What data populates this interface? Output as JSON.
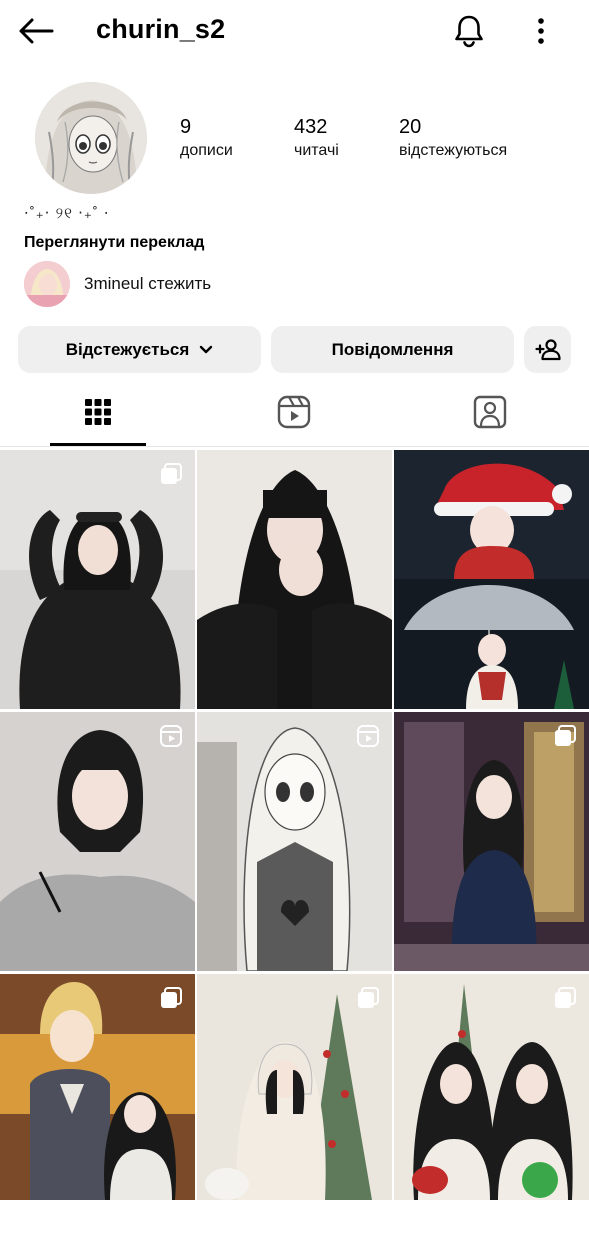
{
  "header": {
    "username": "churin_s2"
  },
  "profile": {
    "stats": [
      {
        "value": "9",
        "label": "дописи"
      },
      {
        "value": "432",
        "label": "читачі"
      },
      {
        "value": "20",
        "label": "відстежуються"
      }
    ],
    "bio": "⋅˚₊‧ ୨୧ ‧₊˚ ⋅",
    "translate_label": "Переглянути переклад",
    "followed_by": {
      "name": "3mineul",
      "suffix": " стежить"
    }
  },
  "actions": {
    "following_label": "Відстежується",
    "message_label": "Повідомлення"
  },
  "tabs": [
    {
      "icon": "grid-icon",
      "active": true
    },
    {
      "icon": "reels-icon",
      "active": false
    },
    {
      "icon": "tagged-icon",
      "active": false
    }
  ],
  "posts": [
    {
      "type": "carousel",
      "subject": "girl in black sweatshirt"
    },
    {
      "type": "photo",
      "subject": "girl covering face"
    },
    {
      "type": "photo",
      "subject": "santa hat and umbrella collage"
    },
    {
      "type": "reel",
      "subject": "girl in grey top"
    },
    {
      "type": "reel",
      "subject": "manga girl illustration"
    },
    {
      "type": "carousel",
      "subject": "girl in navy cardigan"
    },
    {
      "type": "carousel",
      "subject": "anime cutout with girl"
    },
    {
      "type": "carousel",
      "subject": "girl with headscarf by tree"
    },
    {
      "type": "carousel",
      "subject": "two girls by christmas tree"
    }
  ],
  "colors": {
    "button_bg": "#efefef",
    "divider": "#e6e6e6",
    "text": "#000000"
  }
}
